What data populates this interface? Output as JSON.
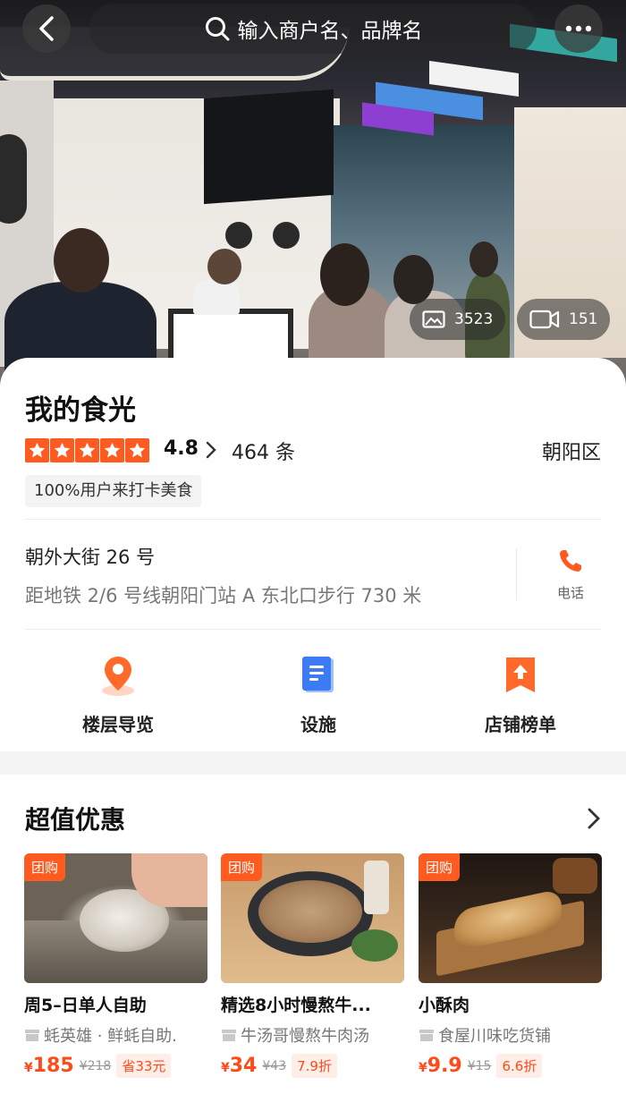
{
  "search": {
    "placeholder": "输入商户名、品牌名"
  },
  "media": {
    "photos": "3523",
    "videos": "151"
  },
  "shop": {
    "name": "我的食光",
    "rating": "4.8",
    "reviews": "464 条",
    "district": "朝阳区",
    "tag": "100%用户来打卡美食",
    "address": "朝外大街 26 号",
    "subway": "距地铁 2/6 号线朝阳门站 A 东北口步行 730 米",
    "phone_label": "电话"
  },
  "features": [
    {
      "label": "楼层导览",
      "icon": "location-pin-icon"
    },
    {
      "label": "设施",
      "icon": "document-icon"
    },
    {
      "label": "店铺榜单",
      "icon": "ranking-bookmark-icon"
    }
  ],
  "deals": {
    "title": "超值优惠",
    "items": [
      {
        "badge": "团购",
        "name": "周5–日单人自助",
        "shop": "蚝英雄 · 鲜蚝自助.",
        "currency": "¥",
        "price": "185",
        "original": "¥218",
        "discount": "省33元"
      },
      {
        "badge": "团购",
        "name": "精选8小时慢熬牛...",
        "shop": "牛汤哥慢熬牛肉汤",
        "currency": "¥",
        "price": "34",
        "original": "¥43",
        "discount": "7.9折"
      },
      {
        "badge": "团购",
        "name": "小酥肉",
        "shop": "食屋川味吃货铺",
        "currency": "¥",
        "price": "9.9",
        "original": "¥15",
        "discount": "6.6折"
      }
    ]
  },
  "colors": {
    "accent": "#ff5a1f",
    "price": "#ff4a1a",
    "info_blue": "#3d7bf5"
  }
}
